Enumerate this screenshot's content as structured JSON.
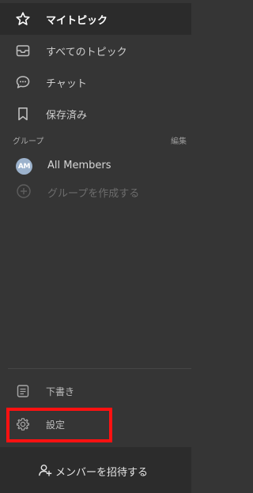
{
  "nav": {
    "items": [
      {
        "label": "マイトピック",
        "icon": "star-icon",
        "active": true
      },
      {
        "label": "すべてのトピック",
        "icon": "inbox-icon",
        "active": false
      },
      {
        "label": "チャット",
        "icon": "chat-bubble-icon",
        "active": false
      },
      {
        "label": "保存済み",
        "icon": "bookmark-icon",
        "active": false
      }
    ]
  },
  "groups": {
    "title": "グループ",
    "edit_label": "編集",
    "items": [
      {
        "avatar_text": "AM",
        "label": "All Members",
        "avatar_color": "#9cb2cc"
      }
    ],
    "create_label": "グループを作成する"
  },
  "bottom": {
    "drafts_label": "下書き",
    "settings_label": "設定"
  },
  "invite": {
    "label": "メンバーを招待する"
  },
  "colors": {
    "background": "#353535",
    "active_background": "#2b2b2b",
    "highlight": "#ff1111",
    "avatar": "#9cb2cc"
  }
}
